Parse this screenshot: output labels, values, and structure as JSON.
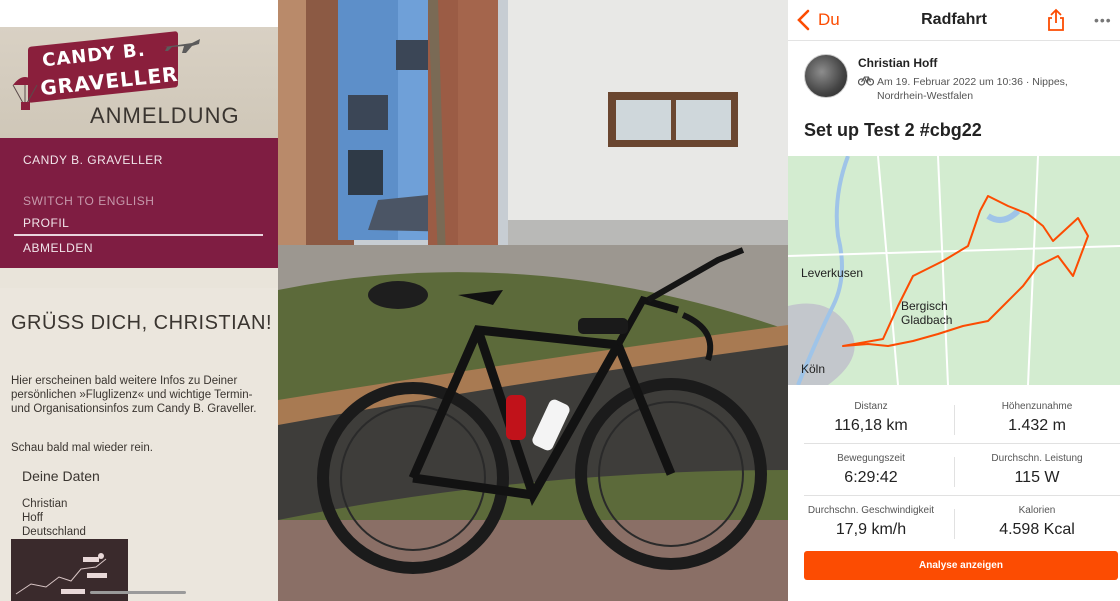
{
  "website": {
    "logo_line1": "CANDY B.",
    "logo_line2": "GRAVELLER",
    "page_heading": "ANMELDUNG",
    "menu": {
      "title": "CANDY B. GRAVELLER",
      "switch_language": "SWITCH TO ENGLISH",
      "profile": "PROFIL",
      "logout": "ABMELDEN"
    },
    "greeting": "GRÜSS DICH, CHRISTIAN!",
    "info_text": "Hier erscheinen bald weitere Infos zu Deiner persönlichen »Fluglizenz« und wichtige Termin- und Organisationsinfos zum Candy B. Graveller.",
    "come_back_text": "Schau bald mal wieder rein.",
    "your_data_title": "Deine Daten",
    "your_data": [
      "Christian",
      "Hoff",
      "Deutschland"
    ]
  },
  "activity": {
    "back_label": "Du",
    "nav_title": "Radfahrt",
    "athlete_name": "Christian Hoff",
    "meta": "Am 19. Februar 2022 um 10:36 · Nippes, Nordrhein-Westfalen",
    "title": "Set up Test 2 #cbg22",
    "map_labels": {
      "leverkusen": "Leverkusen",
      "bergisch": "Bergisch",
      "gladbach": "Gladbach",
      "koeln": "Köln"
    },
    "stats": [
      {
        "label": "Distanz",
        "value": "116,18 km"
      },
      {
        "label": "Höhenzunahme",
        "value": "1.432 m"
      },
      {
        "label": "Bewegungszeit",
        "value": "6:29:42"
      },
      {
        "label": "Durchschn. Leistung",
        "value": "115 W"
      },
      {
        "label": "Durchschn. Geschwindigkeit",
        "value": "17,9 km/h"
      },
      {
        "label": "Kalorien",
        "value": "4.598 Kcal"
      }
    ],
    "analyse_button": "Analyse anzeigen",
    "accent_color": "#fc4c02"
  }
}
